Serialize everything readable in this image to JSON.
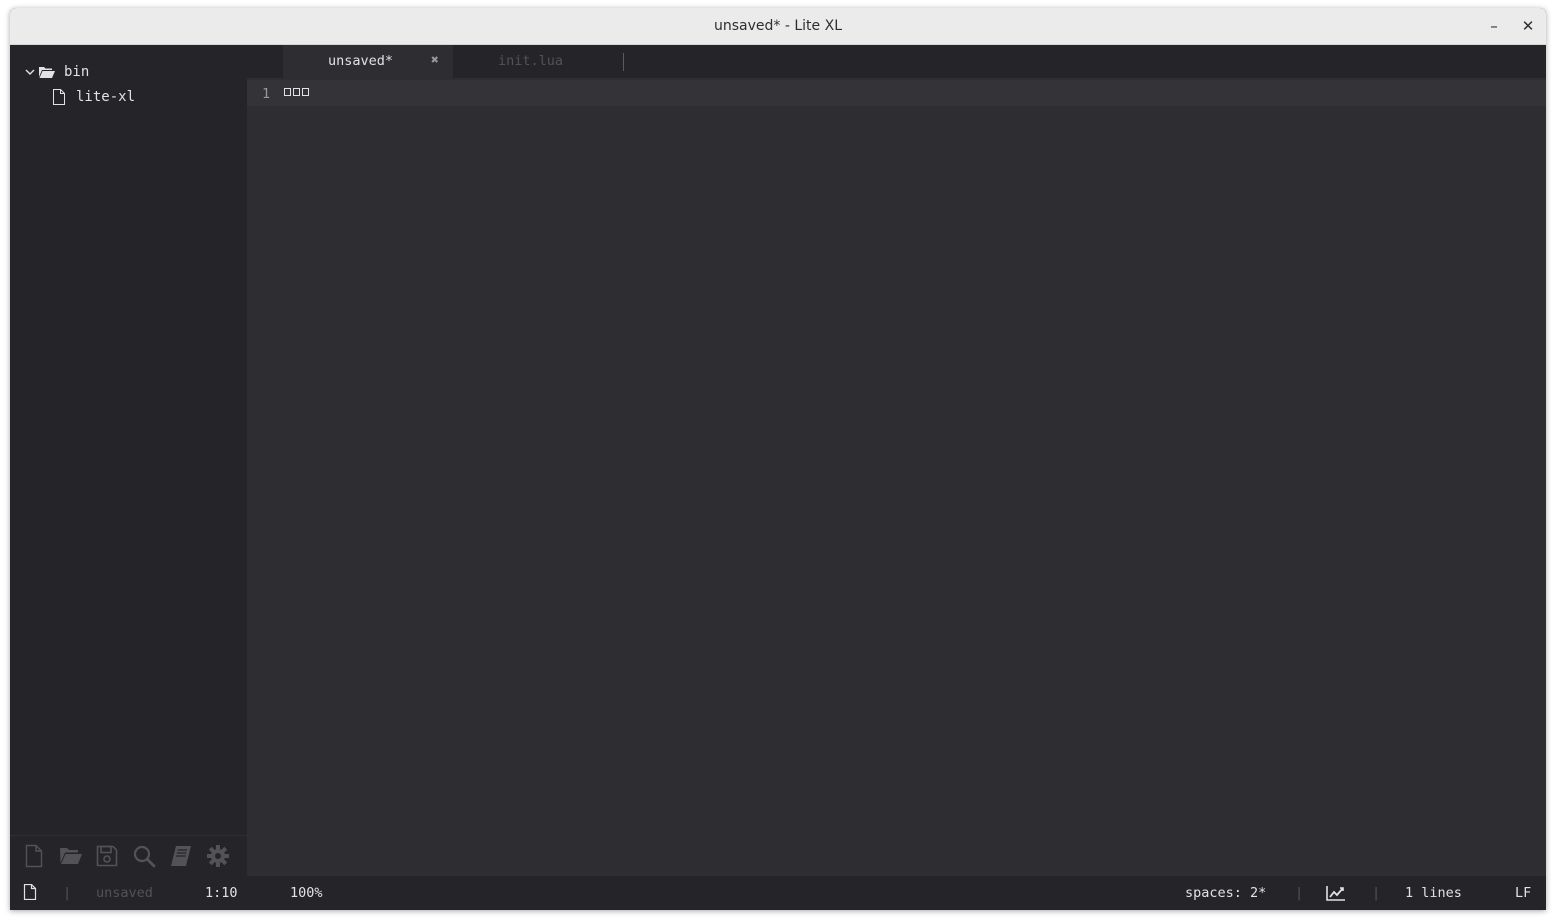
{
  "window": {
    "title": "unsaved* - Lite XL",
    "minimize_glyph": "–",
    "close_glyph": "✕"
  },
  "sidebar": {
    "tree": [
      {
        "label": "bin",
        "type": "folder-open",
        "icon": "folder-open-icon",
        "expanded": true
      },
      {
        "label": "lite-xl",
        "type": "file",
        "icon": "file-icon"
      }
    ],
    "toolbar": [
      {
        "name": "new-file",
        "icon": "new-file-icon"
      },
      {
        "name": "open-folder",
        "icon": "open-folder-icon"
      },
      {
        "name": "save",
        "icon": "save-icon"
      },
      {
        "name": "find",
        "icon": "search-icon"
      },
      {
        "name": "commands",
        "icon": "book-icon"
      },
      {
        "name": "settings",
        "icon": "gear-icon"
      }
    ]
  },
  "tabs": [
    {
      "label": "unsaved*",
      "active": true,
      "close_glyph": "✖"
    },
    {
      "label": "init.lua",
      "active": false
    }
  ],
  "editor": {
    "line_number": "1",
    "line_content_glyph_boxes": 3
  },
  "statusbar": {
    "separator": "|",
    "file_name": "unsaved",
    "position": "1:10",
    "zoom": "100%",
    "indent": "spaces: 2*",
    "line_count": "1 lines",
    "line_ending": "LF"
  },
  "colors": {
    "background": "#2e2e32",
    "panel": "#252529",
    "text": "#e1e1e6",
    "dim_text": "#525257",
    "titlebar": "#ebebeb"
  }
}
